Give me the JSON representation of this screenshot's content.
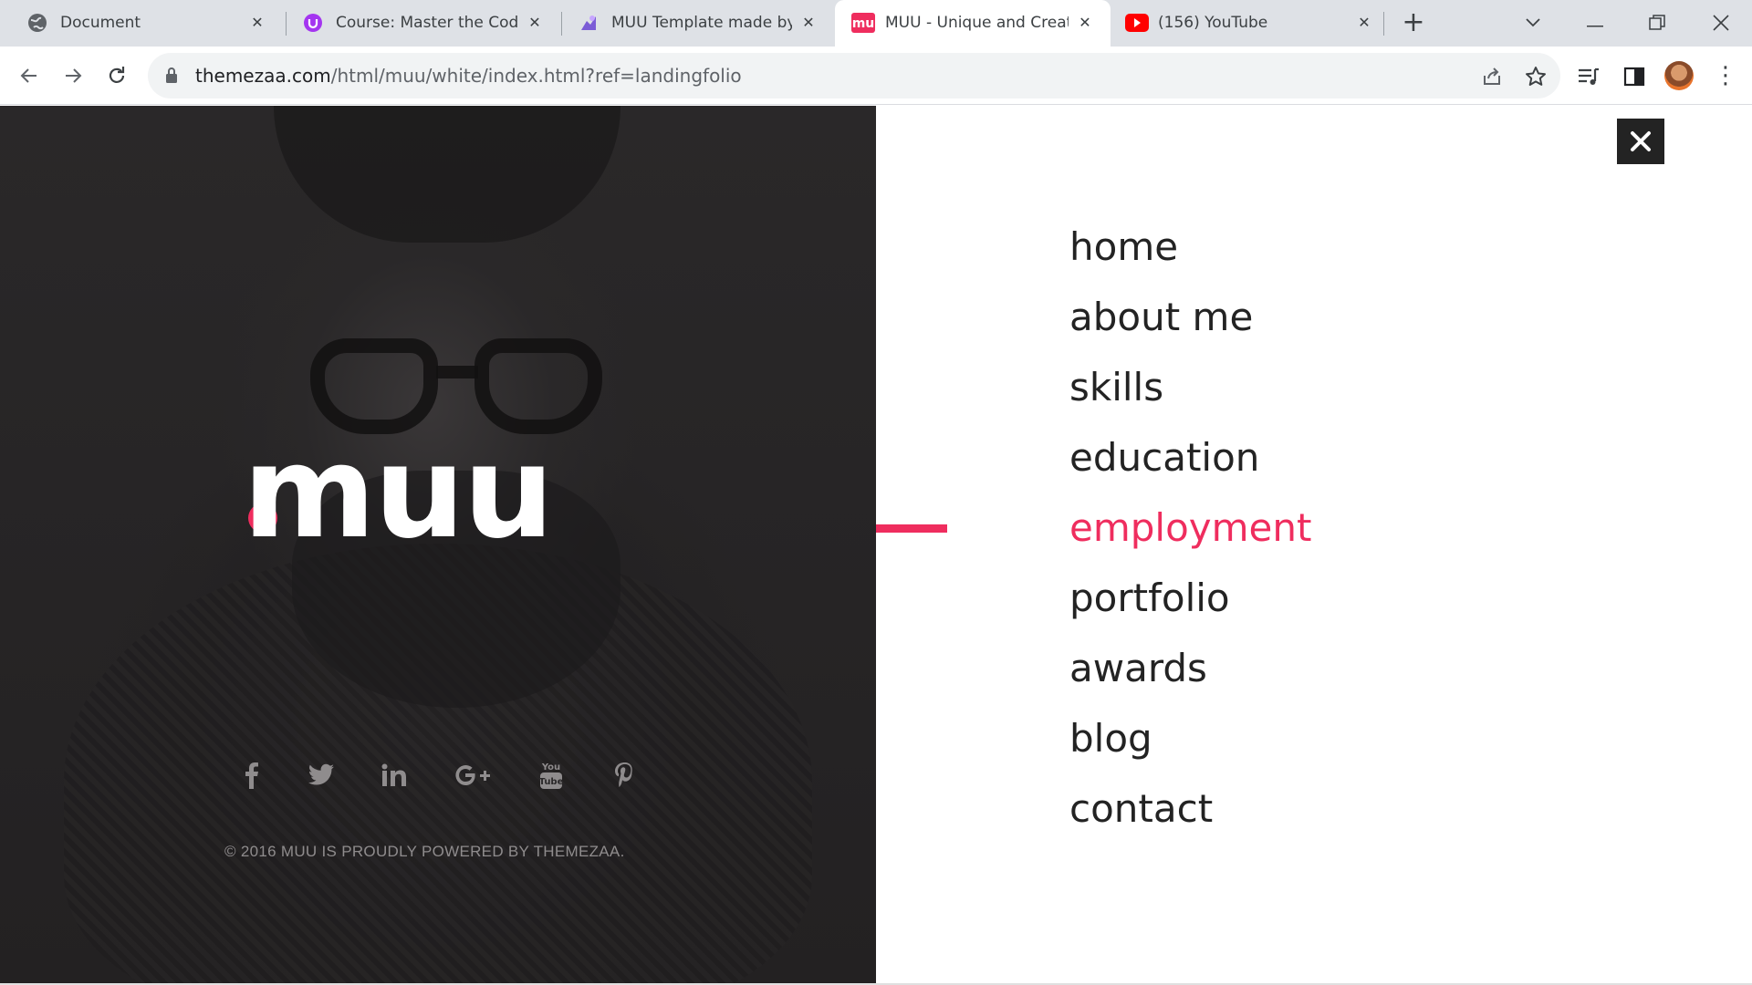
{
  "browser": {
    "tabs": [
      {
        "title": "Document",
        "icon": "globe-icon",
        "active": false
      },
      {
        "title": "Course: Master the Codin",
        "icon": "course-icon",
        "active": false
      },
      {
        "title": "MUU Template made by",
        "icon": "template-icon",
        "active": false
      },
      {
        "title": "MUU - Unique and Creat",
        "icon": "mu-icon",
        "active": true
      },
      {
        "title": "(156) YouTube",
        "icon": "youtube-icon",
        "active": false
      }
    ],
    "url_host": "themezaa.com",
    "url_path": "/html/muu/white/index.html?ref=landingfolio"
  },
  "brand": {
    "logo_text": "muu",
    "accent_color": "#ef2d5e"
  },
  "menu": {
    "items": [
      "home",
      "about me",
      "skills",
      "education",
      "employment",
      "portfolio",
      "awards",
      "blog",
      "contact"
    ],
    "active": "employment"
  },
  "social": {
    "icons": [
      "facebook-icon",
      "twitter-icon",
      "linkedin-icon",
      "google-plus-icon",
      "youtube-icon",
      "pinterest-icon"
    ],
    "labels": [
      "f",
      "",
      "in",
      "G+",
      "You Tube",
      ""
    ]
  },
  "footer": {
    "copyright": "© 2016 MUU IS PROUDLY POWERED BY THEMEZAA."
  }
}
